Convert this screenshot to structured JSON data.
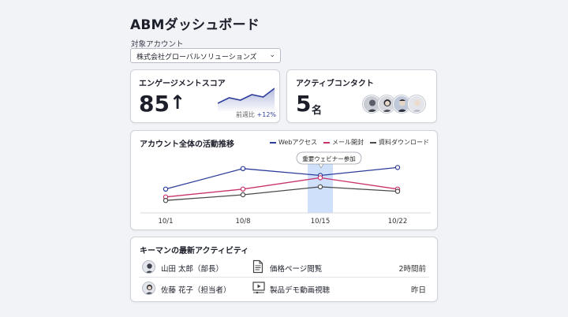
{
  "header": {
    "title": "ABMダッシュボード"
  },
  "account": {
    "label": "対象アカウント",
    "selected": "株式会社グローバルソリューションズ"
  },
  "engagement": {
    "title": "エンゲージメントスコア",
    "score": "85",
    "arrow": "↑",
    "delta_label": "前週比",
    "delta_value": "+12%",
    "sparkline": [
      20,
      34,
      28,
      42,
      36,
      58
    ]
  },
  "contacts": {
    "title": "アクティブコンタクト",
    "count": "5",
    "unit": "名"
  },
  "activity": {
    "title": "アカウント全体の活動推移",
    "annotation": "重要ウェビナー参加",
    "chart_data": {
      "type": "line",
      "categories": [
        "10/1",
        "10/8",
        "10/15",
        "10/22"
      ],
      "series": [
        {
          "name": "Webアクセス",
          "color": "#2c3d9c",
          "values": [
            42,
            78,
            66,
            80
          ]
        },
        {
          "name": "メール開封",
          "color": "#c8336c",
          "values": [
            28,
            42,
            62,
            42
          ]
        },
        {
          "name": "資料ダウンロード",
          "color": "#4a4a4a",
          "values": [
            22,
            32,
            46,
            38
          ]
        }
      ],
      "highlight_category": "10/15",
      "ylim": [
        0,
        100
      ]
    }
  },
  "feed": {
    "title": "キーマンの最新アクティビティ",
    "items": [
      {
        "name": "山田 太郎（部長）",
        "icon": "document-icon",
        "action": "価格ページ閲覧",
        "time": "2時間前"
      },
      {
        "name": "佐藤 花子（担当者）",
        "icon": "video-icon",
        "action": "製品デモ動画視聴",
        "time": "昨日"
      }
    ]
  }
}
